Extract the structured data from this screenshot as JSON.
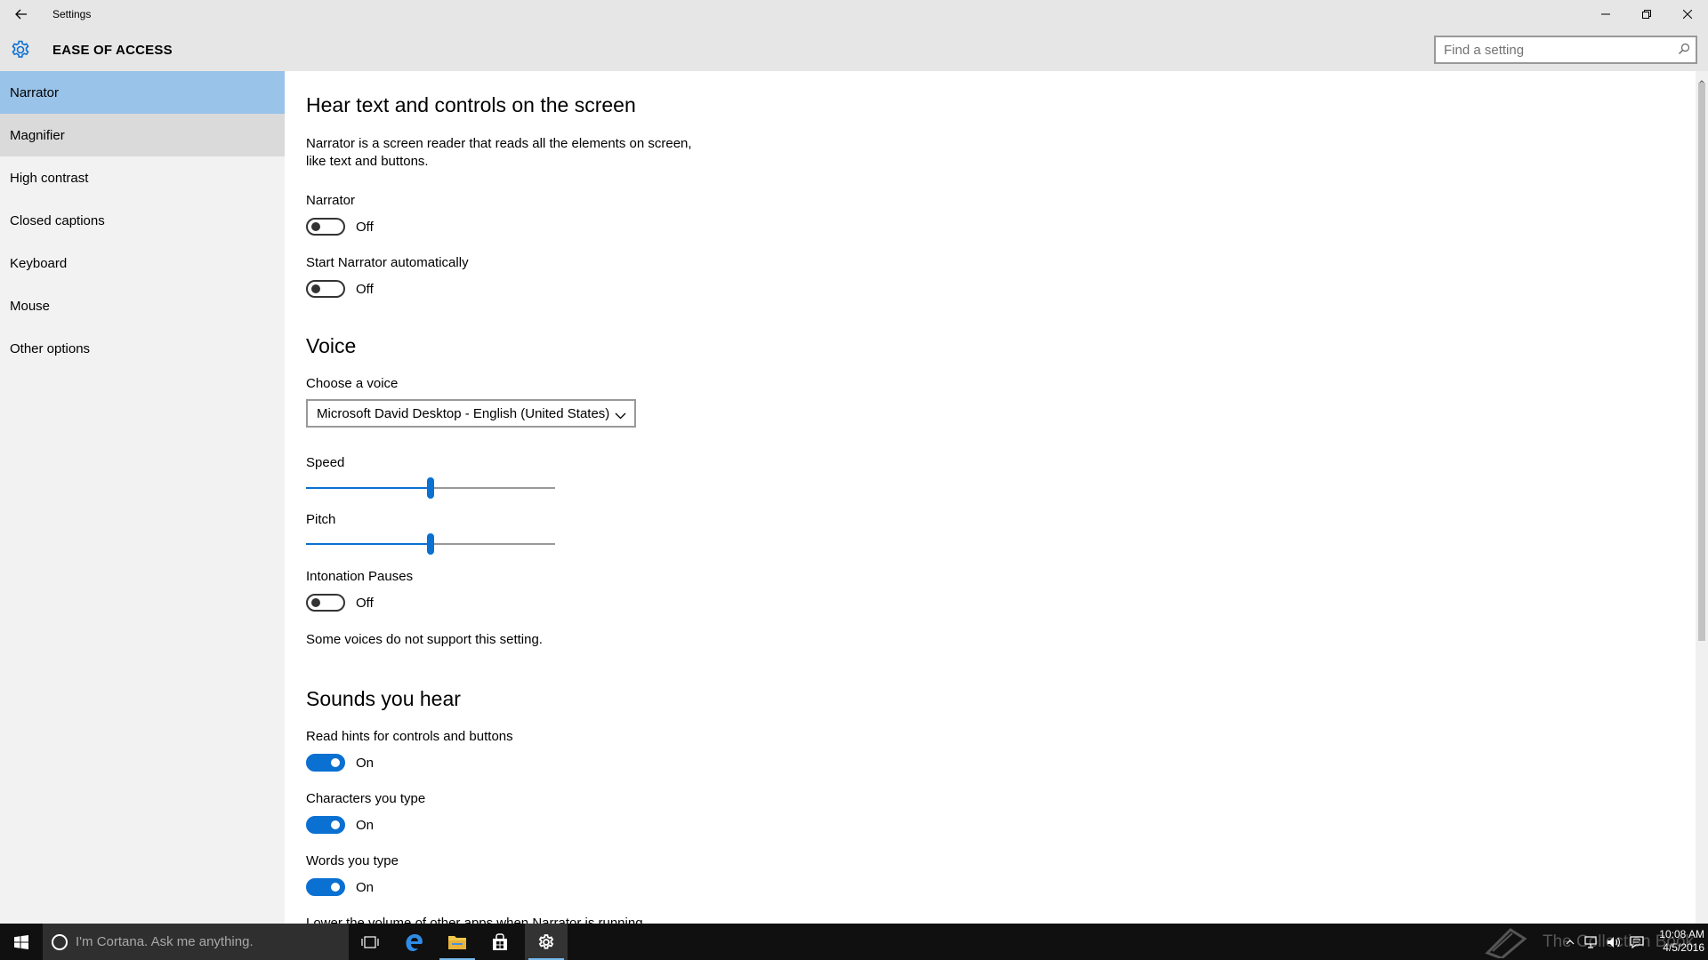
{
  "window": {
    "title": "Settings"
  },
  "header": {
    "section_title": "EASE OF ACCESS",
    "search_placeholder": "Find a setting"
  },
  "sidebar": {
    "items": [
      {
        "label": "Narrator",
        "state": "selected"
      },
      {
        "label": "Magnifier",
        "state": "hover"
      },
      {
        "label": "High contrast"
      },
      {
        "label": "Closed captions"
      },
      {
        "label": "Keyboard"
      },
      {
        "label": "Mouse"
      },
      {
        "label": "Other options"
      }
    ]
  },
  "main": {
    "heading": "Hear text and controls on the screen",
    "description_line1": "Narrator is a screen reader that reads all the elements on screen,",
    "description_line2": "like text and buttons.",
    "narrator": {
      "label": "Narrator",
      "value": "Off"
    },
    "start_auto": {
      "label": "Start Narrator automatically",
      "value": "Off"
    },
    "voice_heading": "Voice",
    "choose_voice_label": "Choose a voice",
    "voice_selected": "Microsoft David Desktop - English (United States)",
    "speed": {
      "label": "Speed",
      "level": 0.5
    },
    "pitch": {
      "label": "Pitch",
      "level": 0.5
    },
    "intonation": {
      "label": "Intonation Pauses",
      "value": "Off"
    },
    "intonation_note": "Some voices do not support this setting.",
    "sounds_heading": "Sounds you hear",
    "read_hints": {
      "label": "Read hints for controls and buttons",
      "value": "On"
    },
    "chars_typed": {
      "label": "Characters you type",
      "value": "On"
    },
    "words_typed": {
      "label": "Words you type",
      "value": "On"
    },
    "lower_volume_label": "Lower the volume of other apps when Narrator is running"
  },
  "taskbar": {
    "cortana_placeholder": "I'm Cortana. Ask me anything.",
    "watermark": "The Collection Book",
    "time": "10:08 AM",
    "date": "4/5/2016"
  },
  "colors": {
    "accent": "#0a70d2",
    "selected_nav": "#99c3e9",
    "chrome": "#e6e6e6",
    "sidebar": "#f2f2f2",
    "taskbar": "#101010"
  }
}
